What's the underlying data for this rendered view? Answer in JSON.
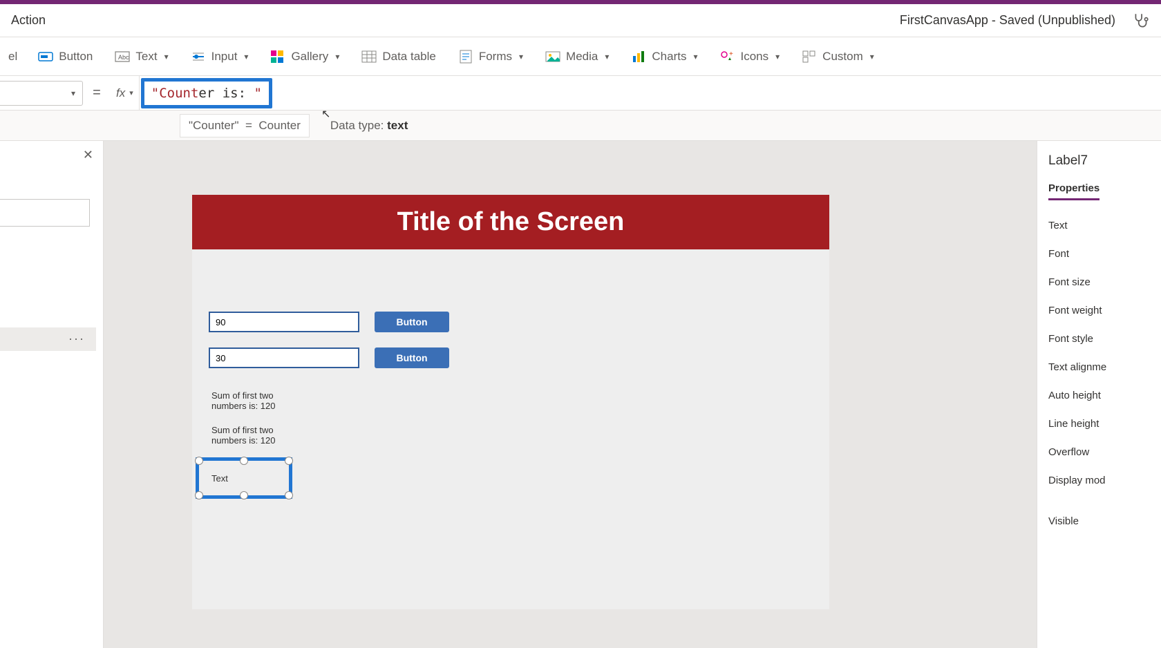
{
  "title_bar": {
    "action_label": "Action",
    "app_title": "FirstCanvasApp - Saved (Unpublished)"
  },
  "ribbon": {
    "label_trunc": "el",
    "button_label": "Button",
    "text_label": "Text",
    "input_label": "Input",
    "gallery_label": "Gallery",
    "datatable_label": "Data table",
    "forms_label": "Forms",
    "media_label": "Media",
    "charts_label": "Charts",
    "icons_label": "Icons",
    "custom_label": "Custom"
  },
  "formula": {
    "fx": "fx",
    "equals": "=",
    "value_red": "\"Count",
    "value_black_mid": "er is: ",
    "value_red_close": "\"",
    "hint_left": "\"Counter\"",
    "hint_eq": "=",
    "hint_right": "Counter",
    "data_type_label": "Data type:",
    "data_type_value": "text"
  },
  "canvas": {
    "screen_title": "Title of the Screen",
    "input1_value": "90",
    "input2_value": "30",
    "button_label": "Button",
    "sum_label_1": "Sum of first two numbers is: 120",
    "sum_label_2": "Sum of first two numbers is: 120",
    "selected_text": "Text"
  },
  "left_panel": {
    "more": "···"
  },
  "props": {
    "selected_name": "Label7",
    "tab_properties": "Properties",
    "items": [
      "Text",
      "Font",
      "Font size",
      "Font weight",
      "Font style",
      "Text alignme",
      "Auto height",
      "Line height",
      "Overflow",
      "Display mod",
      "Visible"
    ]
  }
}
